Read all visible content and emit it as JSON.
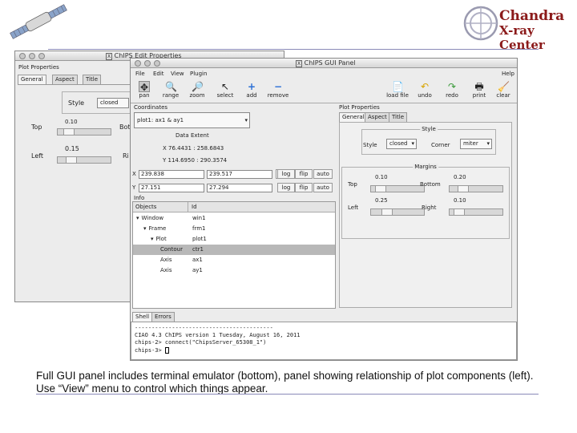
{
  "logo": {
    "line1": "Chandra",
    "line2": "X-ray Center"
  },
  "edit_window": {
    "title": "ChIPS Edit Properties",
    "group_title": "Plot Properties",
    "tabs": [
      "General",
      "Aspect",
      "Title"
    ],
    "style_label": "Style",
    "style_value": "closed",
    "top_label": "Top",
    "top_value": "0.10",
    "left_label": "Left",
    "left_value": "0.15",
    "bottom_label_partial": "Bot",
    "right_label_partial": "Ri"
  },
  "gui_window": {
    "title": "ChIPS GUI Panel",
    "menu": [
      "File",
      "Edit",
      "View",
      "Plugin"
    ],
    "help": "Help",
    "toolbar": [
      "pan",
      "range",
      "zoom",
      "select",
      "add",
      "remove"
    ],
    "toolbar_right": [
      "load file",
      "undo",
      "redo",
      "print",
      "clear"
    ],
    "coordinates": {
      "title": "Coordinates",
      "object": "plot1: ax1 & ay1",
      "data_extent_label": "Data Extent",
      "x_extent": "X 76.4431 : 258.6843",
      "y_extent": "Y 114.6950 : 290.3574",
      "x_label": "X",
      "x_min": "239.838",
      "x_max": "239.517",
      "y_label": "Y",
      "y_min": "27.151",
      "y_max": "27.294",
      "buttons": [
        "≤",
        "log",
        "flip",
        "auto"
      ]
    },
    "info": {
      "title": "Info",
      "columns": [
        "Objects",
        "Id"
      ],
      "rows": [
        {
          "object": "Window",
          "id": "win1",
          "prefix": "▾",
          "indent": 0,
          "selected": false
        },
        {
          "object": "Frame",
          "id": "frm1",
          "prefix": "▾",
          "indent": 1,
          "selected": false
        },
        {
          "object": "Plot",
          "id": "plot1",
          "prefix": "▾",
          "indent": 2,
          "selected": false
        },
        {
          "object": "Contour",
          "id": "ctr1",
          "prefix": "",
          "indent": 3,
          "selected": true
        },
        {
          "object": "Axis",
          "id": "ax1",
          "prefix": "",
          "indent": 3,
          "selected": false
        },
        {
          "object": "Axis",
          "id": "ay1",
          "prefix": "",
          "indent": 3,
          "selected": false
        }
      ]
    },
    "plot_properties": {
      "title": "Plot Properties",
      "tabs": [
        "General",
        "Aspect",
        "Title"
      ],
      "style_group": "Style",
      "style_label": "Style",
      "style_value": "closed",
      "corner_label": "Corner",
      "corner_value": "miter",
      "margins_group": "Margins",
      "top_label": "Top",
      "top_value": "0.10",
      "top_level": 0.1,
      "bottom_label": "Bottom",
      "bottom_value": "0.20",
      "bottom_level": 0.2,
      "left_label": "Left",
      "left_value": "0.25",
      "left_level": 0.25,
      "right_label": "Right",
      "right_value": "0.10",
      "right_level": 0.1
    },
    "terminal": {
      "tabs": [
        "Shell",
        "Errors"
      ],
      "lines": [
        "-----------------------------------------",
        "CIAO 4.3 ChIPS version 1 Tuesday, August 16, 2011",
        "",
        "chips-2> connect(\"ChipsServer_65308_1\")",
        "chips-3> "
      ]
    }
  },
  "caption": "Full GUI panel includes terminal emulator (bottom), panel showing relationship of plot components (left).  Use “View”  menu to control which things appear."
}
